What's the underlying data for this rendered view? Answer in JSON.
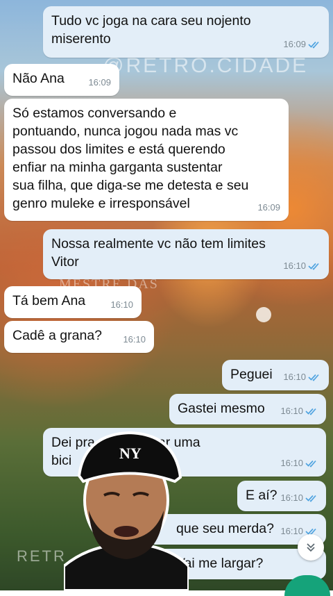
{
  "watermarks": {
    "top": "@RETRO.CIDADE",
    "middle": "MESTRE DAS\nMASS.",
    "bottom": "RETR"
  },
  "messages": [
    {
      "direction": "out",
      "text": "Tudo vc joga na cara seu nojento\nmiserento",
      "time": "16:09",
      "status": "read"
    },
    {
      "direction": "in",
      "text": "Não Ana",
      "time": "16:09"
    },
    {
      "direction": "in",
      "text": "Só estamos conversando e\npontuando, nunca jogou nada mas vc\npassou dos limites e está querendo\nenfiar na minha garganta sustentar\nsua filha, que diga-se me detesta e seu\ngenro muleke e irresponsável",
      "time": "16:09"
    },
    {
      "direction": "out",
      "text": "Nossa realmente vc não tem limites\nVitor",
      "time": "16:10",
      "status": "read"
    },
    {
      "direction": "in",
      "text": "Tá bem Ana",
      "time": "16:10"
    },
    {
      "direction": "in",
      "text": "Cadê a grana?",
      "time": "16:10"
    },
    {
      "direction": "out",
      "text": "Peguei",
      "time": "16:10",
      "status": "read"
    },
    {
      "direction": "out",
      "text": "Gastei mesmo",
      "time": "16:10",
      "status": "read"
    },
    {
      "direction": "out",
      "text": "Dei pra ela comprar uma\nbici",
      "time": "16:10",
      "status": "read"
    },
    {
      "direction": "out",
      "text": "E aí?",
      "time": "16:10",
      "status": "read"
    },
    {
      "direction": "out",
      "text": "que seu merda?",
      "time": "16:10",
      "status": "read"
    },
    {
      "direction": "out",
      "text": "Vai me largar?",
      "time": "",
      "status": ""
    }
  ],
  "colors": {
    "incoming_bubble": "#ffffff",
    "outgoing_bubble": "#e3eef8",
    "read_ticks": "#4fa3e0",
    "fab_green": "#15a37a"
  },
  "icons": {
    "scroll_down": "chevron-double-down-icon",
    "read_receipt": "double-check-icon"
  }
}
